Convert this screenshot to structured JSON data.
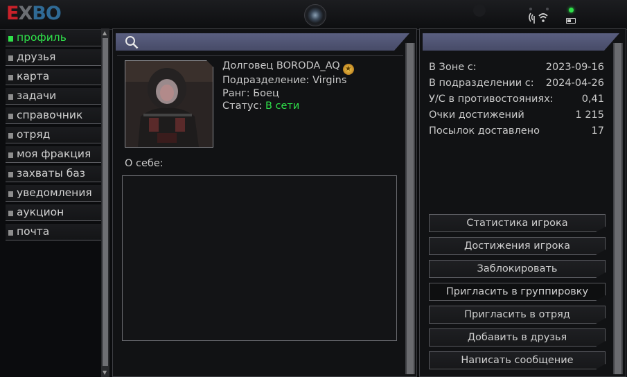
{
  "app": {
    "logo_e": "E",
    "logo_x": "X",
    "logo_bo": "BO"
  },
  "status_bar": {
    "wifi_icon": "wifi-icon",
    "battery_icon": "battery-icon",
    "led_color": "#2fe04a"
  },
  "sidebar": {
    "items": [
      {
        "label": "профиль",
        "active": true
      },
      {
        "label": "друзья"
      },
      {
        "label": "карта"
      },
      {
        "label": "задачи"
      },
      {
        "label": "справочник"
      },
      {
        "label": "отряд"
      },
      {
        "label": "моя фракция"
      },
      {
        "label": "захваты баз"
      },
      {
        "label": "уведомления"
      },
      {
        "label": "аукцион"
      },
      {
        "label": "почта"
      }
    ]
  },
  "profile": {
    "name": "Долговец BORODA_AQ",
    "division_label": "Подразделение:",
    "division": "Virgins",
    "rank_label": "Ранг:",
    "rank": "Боец",
    "status_label": "Статус:",
    "status": "В сети",
    "about_label": "О себе:",
    "about_text": ""
  },
  "stats": [
    {
      "label": "В Зоне с:",
      "value": "2023-09-16"
    },
    {
      "label": "В подразделении с:",
      "value": "2024-04-26"
    },
    {
      "label": "У/С в противостояниях:",
      "value": "0,41"
    },
    {
      "label": "Очки достижений",
      "value": "1 215"
    },
    {
      "label": "Посылок доставлено",
      "value": "17"
    }
  ],
  "actions": {
    "player_stats": "Статистика игрока",
    "achievements": "Достижения игрока",
    "block": "Заблокировать",
    "invite_group": "Пригласить в группировку",
    "invite_squad": "Пригласить в отряд",
    "add_friend": "Добавить в друзья",
    "message": "Написать сообщение"
  },
  "colors": {
    "accent": "#2fe04a",
    "header": "#4f536f",
    "logo_red": "#c8212a",
    "logo_blue": "#2f6a95"
  }
}
